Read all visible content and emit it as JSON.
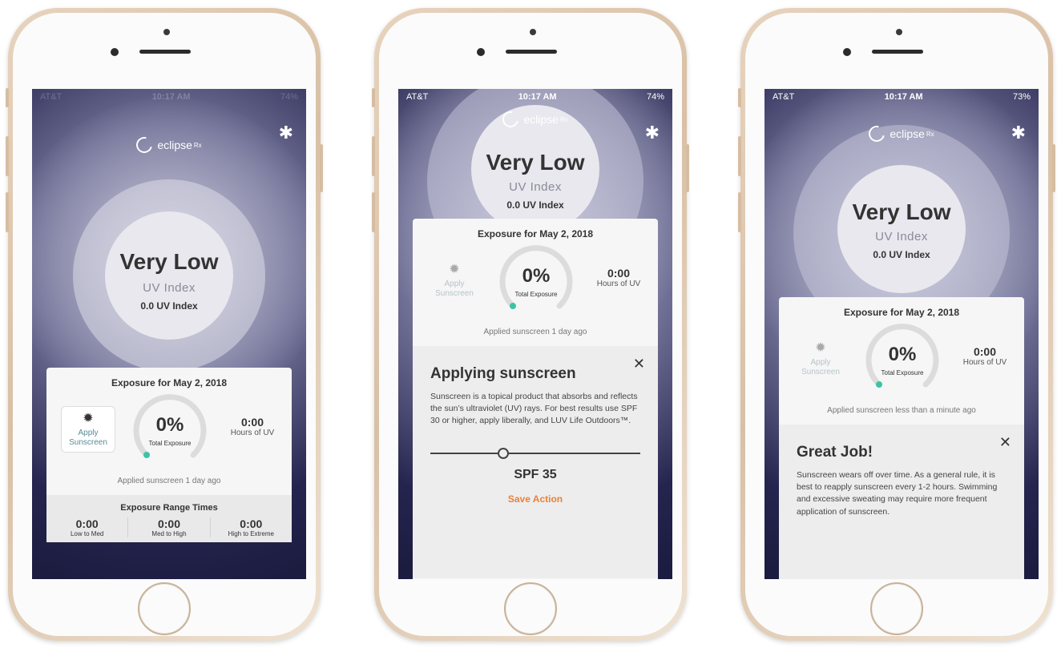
{
  "phones": [
    {
      "status": {
        "carrier": "AT&T",
        "time": "10:17 AM",
        "battery": "74%"
      },
      "brand": "eclipse",
      "brand_mark": "Rx",
      "uv": {
        "level": "Very Low",
        "label": "UV Index",
        "value": "0.0 UV Index"
      },
      "card": {
        "date_title": "Exposure for May 2, 2018",
        "apply_label": "Apply Sunscreen",
        "total_pct": "0%",
        "total_label": "Total Exposure",
        "total_fraction": 0,
        "hours_value": "0:00",
        "hours_label": "Hours of UV",
        "applied_note": "Applied sunscreen 1 day ago"
      },
      "ranges": {
        "title": "Exposure Range Times",
        "items": [
          {
            "value": "0:00",
            "label": "Low to Med"
          },
          {
            "value": "0:00",
            "label": "Med to High"
          },
          {
            "value": "0:00",
            "label": "High to Extreme"
          }
        ]
      }
    },
    {
      "status": {
        "carrier": "AT&T",
        "time": "10:17 AM",
        "battery": "74%"
      },
      "brand": "eclipse",
      "brand_mark": "Rx",
      "uv": {
        "level": "Very Low",
        "label": "UV Index",
        "value": "0.0 UV Index"
      },
      "card": {
        "date_title": "Exposure for May 2, 2018",
        "apply_label": "Apply Sunscreen",
        "total_pct": "0%",
        "total_label": "Total Exposure",
        "total_fraction": 0,
        "hours_value": "0:00",
        "hours_label": "Hours of UV",
        "applied_note": "Applied sunscreen 1 day ago"
      },
      "panel": {
        "title": "Applying sunscreen",
        "text": "Sunscreen is a topical product that absorbs and reflects the sun’s ultraviolet (UV) rays. For best results use SPF 30 or higher, apply liberally, and LUV Life Outdoors™.",
        "spf_label": "SPF 35",
        "save_label": "Save Action"
      }
    },
    {
      "status": {
        "carrier": "AT&T",
        "time": "10:17 AM",
        "battery": "73%"
      },
      "brand": "eclipse",
      "brand_mark": "Rx",
      "uv": {
        "level": "Very Low",
        "label": "UV Index",
        "value": "0.0 UV Index"
      },
      "card": {
        "date_title": "Exposure for May 2, 2018",
        "apply_label": "Apply Sunscreen",
        "total_pct": "0%",
        "total_label": "Total Exposure",
        "total_fraction": 0,
        "hours_value": "0:00",
        "hours_label": "Hours of UV",
        "applied_note": "Applied sunscreen less than a minute ago"
      },
      "panel": {
        "title": "Great Job!",
        "text": "Sunscreen wears off over time. As a general rule, it is best to reapply sunscreen every 1-2 hours. Swimming and excessive sweating may require more frequent application of sunscreen."
      }
    }
  ],
  "icons": {
    "bluetooth": "bluetooth-icon",
    "sun": "sun-icon",
    "close": "close-icon"
  },
  "colors": {
    "accent_orange": "#e8823a",
    "gauge_dot": "#3cc3a6",
    "screen_dark": "#1b1b3f"
  }
}
